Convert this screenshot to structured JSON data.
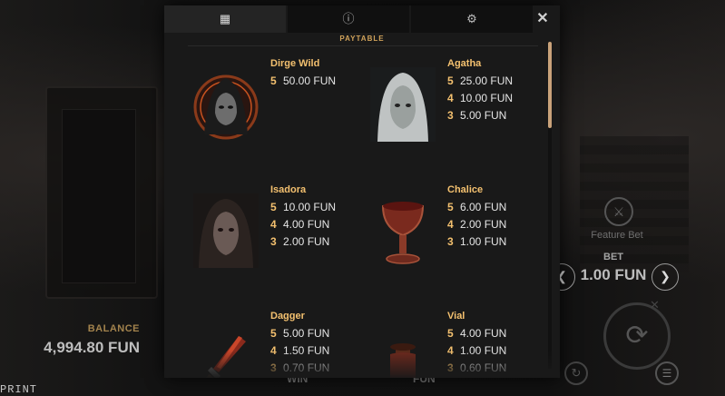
{
  "balance": {
    "label": "BALANCE",
    "value": "4,994.80 FUN"
  },
  "print_label": "PRINT",
  "feature": {
    "label": "Feature Bet"
  },
  "bet": {
    "label": "BET",
    "value": "1.00 FUN",
    "dec": "❮",
    "inc": "❯"
  },
  "bottom_peek": {
    "win": "WIN",
    "fun": "FUN"
  },
  "modal": {
    "tabs": [
      {
        "icon": "▦",
        "name": "paytable-tab"
      },
      {
        "icon": "ⓘ",
        "name": "info-tab"
      },
      {
        "icon": "⚙",
        "name": "settings-tab"
      }
    ],
    "close": "✕",
    "section_title": "PAYTABLE"
  },
  "paytable": [
    {
      "name": "Dirge Wild",
      "pays": [
        {
          "n": "5",
          "v": "50.00 FUN"
        }
      ]
    },
    {
      "name": "Agatha",
      "pays": [
        {
          "n": "5",
          "v": "25.00 FUN"
        },
        {
          "n": "4",
          "v": "10.00 FUN"
        },
        {
          "n": "3",
          "v": "5.00 FUN"
        }
      ]
    },
    {
      "name": "Isadora",
      "pays": [
        {
          "n": "5",
          "v": "10.00 FUN"
        },
        {
          "n": "4",
          "v": "4.00 FUN"
        },
        {
          "n": "3",
          "v": "2.00 FUN"
        }
      ]
    },
    {
      "name": "Chalice",
      "pays": [
        {
          "n": "5",
          "v": "6.00 FUN"
        },
        {
          "n": "4",
          "v": "2.00 FUN"
        },
        {
          "n": "3",
          "v": "1.00 FUN"
        }
      ]
    },
    {
      "name": "Dagger",
      "pays": [
        {
          "n": "5",
          "v": "5.00 FUN"
        },
        {
          "n": "4",
          "v": "1.50 FUN"
        },
        {
          "n": "3",
          "v": "0.70 FUN"
        }
      ]
    },
    {
      "name": "Vial",
      "pays": [
        {
          "n": "5",
          "v": "4.00 FUN"
        },
        {
          "n": "4",
          "v": "1.00 FUN"
        },
        {
          "n": "3",
          "v": "0.60 FUN"
        }
      ]
    }
  ],
  "colors": {
    "accent": "#f3c06f",
    "panel": "#191919",
    "scroll": "#c9a27a"
  }
}
